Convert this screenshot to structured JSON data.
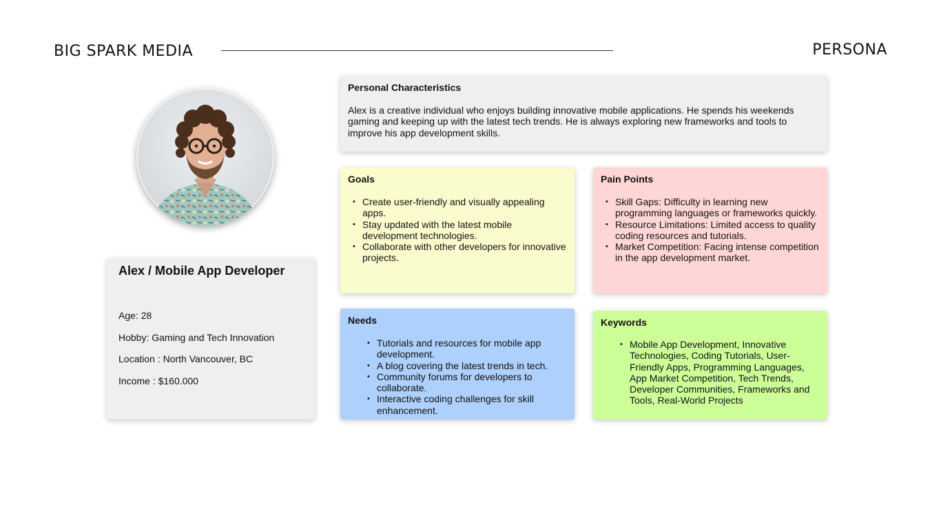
{
  "header": {
    "brand": "BIG SPARK MEDIA",
    "page_label": "PERSONA"
  },
  "profile": {
    "avatar_alt": "portrait-photo",
    "name_title": "Alex / Mobile App Developer",
    "age": "Age: 28",
    "hobby": "Hobby: Gaming and Tech Innovation",
    "location": "Location : North Vancouver, BC",
    "income": "Income : $160.000"
  },
  "characteristics": {
    "title": "Personal Characteristics",
    "text": "Alex is a creative individual who enjoys building innovative mobile applications. He spends his weekends gaming and keeping up with the latest tech trends. He is always exploring new frameworks and tools to improve his app development skills."
  },
  "goals": {
    "title": "Goals",
    "items": [
      "Create user-friendly and visually appealing apps.",
      "Stay updated with the latest mobile development technologies.",
      "Collaborate with other developers for innovative projects."
    ]
  },
  "pain_points": {
    "title": "Pain Points",
    "items": [
      "Skill Gaps: Difficulty in learning new programming languages or frameworks quickly.",
      "Resource Limitations: Limited access to quality coding resources and tutorials.",
      "Market Competition: Facing intense competition in the app development market."
    ]
  },
  "needs": {
    "title": "Needs",
    "items": [
      "Tutorials and resources for mobile app development.",
      "A blog covering the latest trends in tech.",
      "Community forums for developers to collaborate.",
      "Interactive coding challenges for skill enhancement."
    ]
  },
  "keywords": {
    "title": "Keywords",
    "items": [
      "Mobile App Development, Innovative Technologies, Coding Tutorials, User-Friendly Apps, Programming Languages, App Market Competition, Tech Trends, Developer Communities, Frameworks and Tools, Real-World Projects"
    ]
  },
  "colors": {
    "goals_bg": "#fbfccd",
    "pain_bg": "#ffd6d6",
    "needs_bg": "#aed0fc",
    "keywords_bg": "#cdff99",
    "neutral_card_bg": "#efefef"
  }
}
